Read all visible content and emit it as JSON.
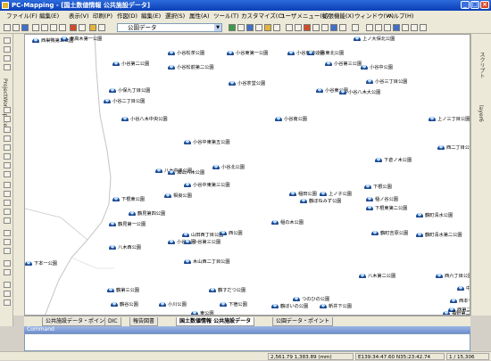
{
  "window": {
    "title": "PC-Mapping - [国土数値情報 公共施設データ]",
    "min_label": "_",
    "max_label": "□",
    "close_label": "×"
  },
  "menu": [
    "ファイル(F)",
    "編集(E)",
    "表示(V)",
    "印刷(P)",
    "作図(D)",
    "編集(E)",
    "選択(S)",
    "属性(A)",
    "ツール(T)",
    "カスタマイズ(C)",
    "ユーザメニュー(U)",
    "拡張機能(X)",
    "ウィンドウ(W)",
    "ヘルプ(H)"
  ],
  "toolbar": {
    "layer_select": "公園データ"
  },
  "left_panel": {
    "label": "ProjectWorkSpace"
  },
  "right_panel": {
    "tab1": "スクリプト",
    "tab2": "layer6"
  },
  "map": {
    "pois": [
      {
        "label": "西巣鴨第二公園"
      },
      {
        "label": "東高木第一公園"
      },
      {
        "label": "上ノ大保北公園"
      },
      {
        "label": "小谷松茶公園"
      },
      {
        "label": "小谷東第一公園"
      },
      {
        "label": "小谷東地公園"
      },
      {
        "label": "小谷第二公園"
      },
      {
        "label": "小谷東北公園"
      },
      {
        "label": "小谷第三公園"
      },
      {
        "label": "小谷中公園"
      },
      {
        "label": "小谷松前第二公園"
      },
      {
        "label": "小谷三丁目公園"
      },
      {
        "label": "小谷茶堂公園"
      },
      {
        "label": "小谷東公園"
      },
      {
        "label": "小保九丁目公園"
      },
      {
        "label": "小谷八木大公園"
      },
      {
        "label": "小谷二丁目公園"
      },
      {
        "label": "小谷八木中央公園"
      },
      {
        "label": "小谷南公園"
      },
      {
        "label": "上ノ三丁目公園"
      },
      {
        "label": "小谷中東第五公園"
      },
      {
        "label": "西二丁目公園"
      },
      {
        "label": "八木中央公園"
      },
      {
        "label": "下倉ノ木公園"
      },
      {
        "label": "畑山八木公園"
      },
      {
        "label": "小谷北公園"
      },
      {
        "label": "小谷中東第三公園"
      },
      {
        "label": "相良公園"
      },
      {
        "label": "下根公園"
      },
      {
        "label": "稲田公園"
      },
      {
        "label": "上ノ子公園"
      },
      {
        "label": "稲ノ谷公園"
      },
      {
        "label": "下根東公園"
      },
      {
        "label": "鶴ぼねみず公園"
      },
      {
        "label": "下根東第二公園"
      },
      {
        "label": "鶴見第四公園"
      },
      {
        "label": "鶴町清水公園"
      },
      {
        "label": "稲の木公園"
      },
      {
        "label": "鶴見第一公園"
      },
      {
        "label": "鶴町吉原公園"
      },
      {
        "label": "山田西丁目公園"
      },
      {
        "label": "西公園"
      },
      {
        "label": "鶴町清水第二公園"
      },
      {
        "label": "小谷公園"
      },
      {
        "label": "小谷第三公園"
      },
      {
        "label": "八木西公園"
      },
      {
        "label": "木山西二丁目公園"
      },
      {
        "label": "八木第二公園"
      },
      {
        "label": "西六丁目公園"
      },
      {
        "label": "鶴第三公園"
      },
      {
        "label": "鶴すだつ公園"
      },
      {
        "label": "つのひの公園"
      },
      {
        "label": "西本一丁目公園"
      },
      {
        "label": "西第二公園"
      },
      {
        "label": "鶴谷公園"
      },
      {
        "label": "鶴ぼいの公園"
      },
      {
        "label": "小川公園"
      },
      {
        "label": "下宿公園"
      },
      {
        "label": "新井下公園"
      },
      {
        "label": "東公園"
      },
      {
        "label": "福野第二公園"
      },
      {
        "label": "下本一公園"
      },
      {
        "label": "中公園"
      }
    ]
  },
  "tabs": [
    "公共施設データ・ポイント",
    "DIC",
    "報告図書",
    "国土数値情報 公共施設データ",
    "公園データ・ポイント"
  ],
  "command": {
    "title": "Command"
  },
  "status": {
    "coords": "2,561.79 1,383.89 (mm)",
    "geo": "E139:34:47.60 N35:23:42.74",
    "count": "1 / 15,306"
  }
}
